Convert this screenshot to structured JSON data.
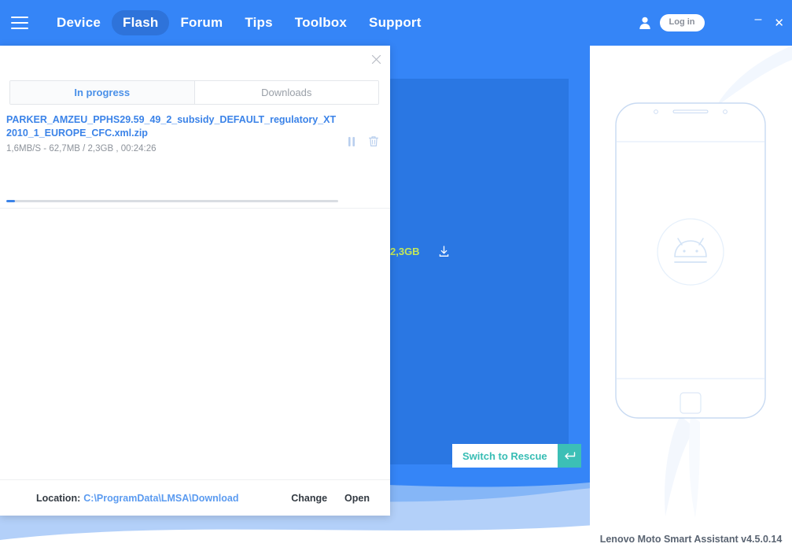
{
  "topbar": {
    "menu_icon": "hamburger-icon",
    "nav": [
      {
        "label": "Device",
        "active": false
      },
      {
        "label": "Flash",
        "active": true
      },
      {
        "label": "Forum",
        "active": false
      },
      {
        "label": "Tips",
        "active": false
      },
      {
        "label": "Toolbox",
        "active": false
      },
      {
        "label": "Support",
        "active": false
      }
    ],
    "user_icon": "user-icon",
    "login_label": "Log in",
    "minimize_label": "–",
    "close_label": "✕",
    "bg_color": "#3585f7",
    "active_pill_color": "#2e73da"
  },
  "stage": {
    "bg_color": "#3585f7",
    "card_color": "#2a77e3",
    "size_label": "2,3GB",
    "size_color": "#c3e85a",
    "download_icon": "download-icon",
    "rescue_label": "Switch to Rescue",
    "rescue_text_color": "#37bdb4",
    "rescue_icon": "return-arrow-icon",
    "rescue_icon_bg": "#3cbfb6"
  },
  "phone_panel": {
    "phone_illustration": "phone-outline-illustration",
    "android_icon": "android-robot-icon",
    "version": "Lenovo Moto Smart Assistant v4.5.0.14"
  },
  "downloads_panel": {
    "close_icon": "close-icon",
    "tabs": [
      {
        "label": "In progress",
        "active": true
      },
      {
        "label": "Downloads",
        "active": false
      }
    ],
    "item": {
      "filename": "PARKER_AMZEU_PPHS29.59_49_2_subsidy_DEFAULT_regulatory_XT2010_1_EUROPE_CFC.xml.zip",
      "stats": "1,6MB/S - 62,7MB / 2,3GB , 00:24:26",
      "speed": "1,6MB/S",
      "downloaded": "62,7MB",
      "total": "2,3GB",
      "time_remaining": "00:24:26",
      "progress_percent": 2.7,
      "pause_icon": "pause-icon",
      "delete_icon": "trash-icon",
      "link_color": "#3b83e8"
    },
    "footer": {
      "location_label": "Location:",
      "location_path": "C:\\ProgramData\\LMSA\\Download",
      "change_label": "Change",
      "open_label": "Open"
    }
  }
}
